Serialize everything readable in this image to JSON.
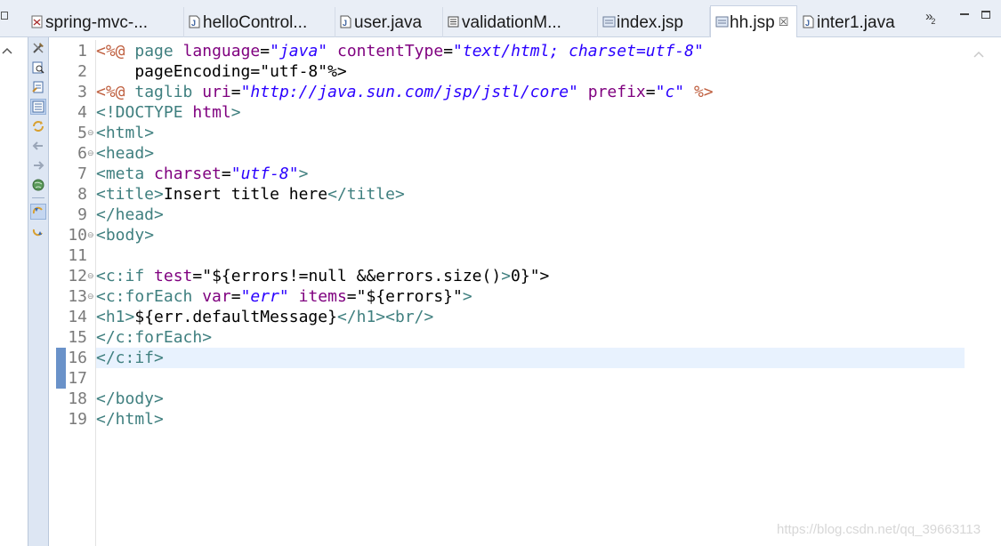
{
  "tabs": [
    {
      "label": "spring-mvc-...",
      "icon": "jar-icon"
    },
    {
      "label": "helloControl...",
      "icon": "java-file-icon"
    },
    {
      "label": "user.java",
      "icon": "java-file-icon"
    },
    {
      "label": "validationM...",
      "icon": "properties-file-icon"
    },
    {
      "label": "index.jsp",
      "icon": "jsp-file-icon"
    },
    {
      "label": "hh.jsp",
      "icon": "jsp-file-icon",
      "active": true,
      "close": "☒"
    },
    {
      "label": "inter1.java",
      "icon": "java-file-icon"
    }
  ],
  "overflow": {
    "symbol": "»",
    "count": "2"
  },
  "editor": {
    "current_line": 16,
    "lines": [
      {
        "n": "1",
        "t": "<%@ page language=\"java\" contentType=\"text/html; charset=utf-8\""
      },
      {
        "n": "2",
        "t": "    pageEncoding=\"utf-8\"%>"
      },
      {
        "n": "3",
        "t": "<%@ taglib uri=\"http://java.sun.com/jsp/jstl/core\" prefix=\"c\" %>"
      },
      {
        "n": "4",
        "t": "<!DOCTYPE html>"
      },
      {
        "n": "5",
        "t": "<html>",
        "fold": true
      },
      {
        "n": "6",
        "t": "<head>",
        "fold": true
      },
      {
        "n": "7",
        "t": "<meta charset=\"utf-8\">"
      },
      {
        "n": "8",
        "t": "<title>Insert title here</title>"
      },
      {
        "n": "9",
        "t": "</head>"
      },
      {
        "n": "10",
        "t": "<body>",
        "fold": true
      },
      {
        "n": "11",
        "t": ""
      },
      {
        "n": "12",
        "t": "<c:if test=\"${errors!=null &&errors.size()>0}\">",
        "fold": true
      },
      {
        "n": "13",
        "t": "<c:forEach var=\"err\" items=\"${errors}\">",
        "fold": true
      },
      {
        "n": "14",
        "t": "<h1>${err.defaultMessage}</h1><br/>"
      },
      {
        "n": "15",
        "t": "</c:forEach>"
      },
      {
        "n": "16",
        "t": "</c:if>"
      },
      {
        "n": "17",
        "t": ""
      },
      {
        "n": "18",
        "t": "</body>"
      },
      {
        "n": "19",
        "t": "</html>"
      }
    ]
  },
  "toolbar_icons": [
    "tools-icon",
    "file-search-icon",
    "file-edit-icon",
    "file-list-icon",
    "sync-icon",
    "back-arrow-icon",
    "forward-arrow-icon",
    "globe-icon",
    "annotation-prev-icon",
    "annotation-next-icon"
  ],
  "watermark": "https://blog.csdn.net/qq_39663113",
  "colors": {
    "tag": "#3f7f7f",
    "attr": "#7f007f",
    "value": "#2a00ff",
    "directive": "#bf5f3f",
    "current_line": "#e8f2fe",
    "toolbar_bg": "#dde6f3"
  }
}
